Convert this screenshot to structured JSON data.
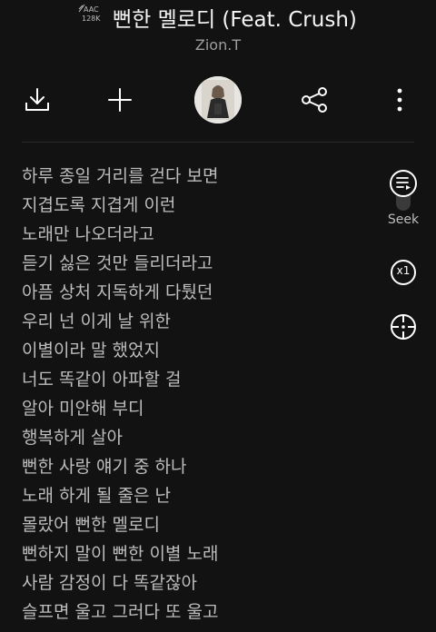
{
  "header": {
    "codec": "AAC",
    "bitrate": "128K",
    "title": "뻔한 멜로디 (Feat. Crush)",
    "artist": "Zion.T"
  },
  "toolbar": {
    "icons": [
      "download-icon",
      "add-icon",
      "album-art",
      "share-icon",
      "more-icon"
    ]
  },
  "lyrics": [
    "하루 종일 거리를 걷다 보면",
    "지겹도록 지겹게 이런",
    "노래만 나오더라고",
    "듣기 싫은 것만 들리더라고",
    "아픔 상처 지독하게 다퉜던",
    "우리 넌 이게 날 위한",
    "이별이라 말 했었지",
    "너도 똑같이 아파할 걸",
    "알아 미안해 부디",
    "행복하게 살아",
    "뻔한 사랑 얘기 중 하나",
    "노래 하게 될 줄은 난",
    "몰랐어 뻔한 멜로디",
    "뻔하지 말이 뻔한 이별 노래",
    "사람 감정이 다 똑같잖아",
    "슬프면 울고 그러다 또 울고"
  ],
  "side": {
    "seek_label": "Seek",
    "speed_label": "x1"
  },
  "colors": {
    "background": "#121212",
    "lyric_text": "#bdbdbd",
    "title_text": "#f5f5f5"
  }
}
